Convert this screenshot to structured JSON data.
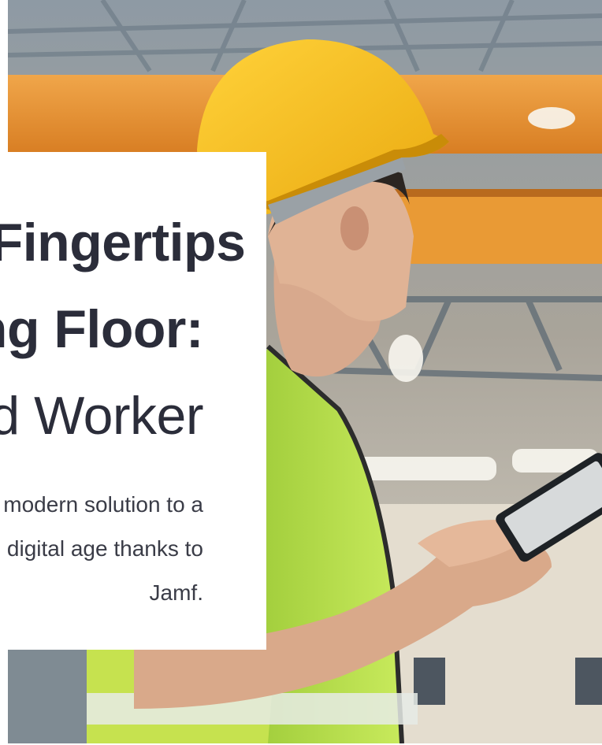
{
  "hero": {
    "headline_line1": "Information at Your Fingertips",
    "headline_line2": "on the Manufacturing Floor:",
    "headline_line3": "Connected Worker",
    "body_line1": "Learn how a manufacturer found a modern solution to a",
    "body_line2": "paper-based process and entered the digital age thanks to",
    "body_line3": "Jamf."
  },
  "photo": {
    "subject": "worker in hard hat and safety vest holding a tablet",
    "colors": {
      "hardhat": "#f3b619",
      "vest": "#b8e04a",
      "crane": "#e9942f",
      "ceiling": "#9aa8b3"
    }
  }
}
